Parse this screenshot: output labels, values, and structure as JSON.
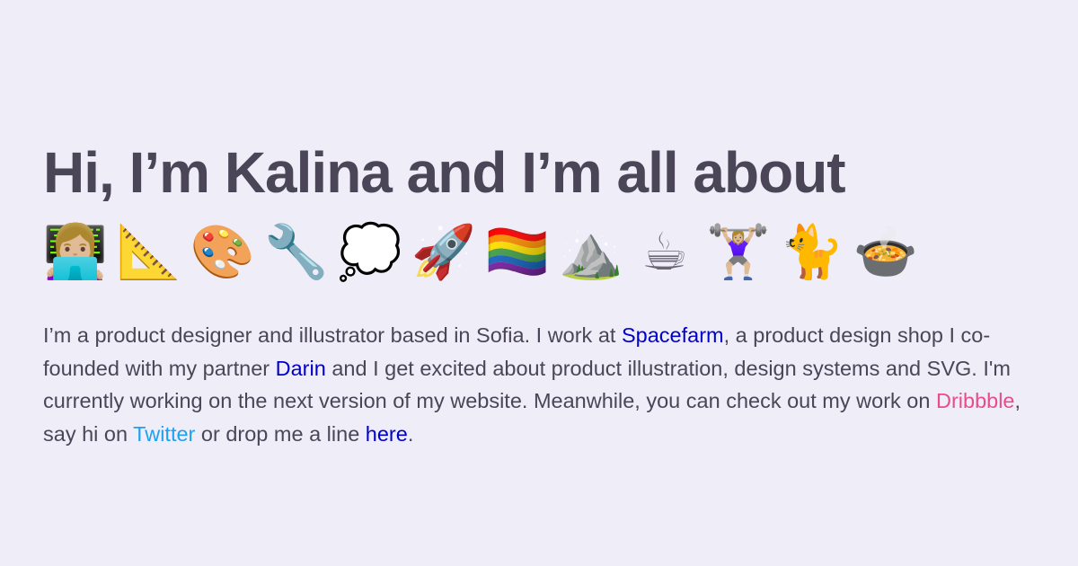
{
  "heading": "Hi, I’m Kalina and I’m all about",
  "emojis": [
    {
      "char": "👩🏼‍💻",
      "name": "woman-technologist-icon"
    },
    {
      "char": "📐",
      "name": "triangular-ruler-icon"
    },
    {
      "char": "🎨",
      "name": "artist-palette-icon"
    },
    {
      "char": "🔧",
      "name": "wrench-icon"
    },
    {
      "char": "💭",
      "name": "thought-balloon-icon"
    },
    {
      "char": "🚀",
      "name": "rocket-icon"
    },
    {
      "char": "🏳️‍🌈",
      "name": "rainbow-flag-icon"
    },
    {
      "char": "⛰️",
      "name": "mountain-icon"
    },
    {
      "char": "☕",
      "name": "hot-beverage-icon"
    },
    {
      "char": "🏋🏼‍♀️",
      "name": "woman-lifting-weights-icon"
    },
    {
      "char": "🐈",
      "name": "cat-icon"
    },
    {
      "char": "🍲",
      "name": "pot-of-food-icon"
    }
  ],
  "intro": {
    "t1": "I’m a product designer and illustrator based in Sofia. I work at ",
    "spacefarm": "Spacefarm",
    "t2": ", a product design shop I co-founded with my partner ",
    "darin": "Darin",
    "t3": " and I get excited about product illustration, design systems and SVG. I'm currently working on the next version of my website. Meanwhile, you can check out my work on ",
    "dribbble": "Dribbble",
    "t4": ", say hi on ",
    "twitter": "Twitter",
    "t5": " or drop me a line ",
    "here": "here",
    "t6": "."
  },
  "colors": {
    "background": "#efedf8",
    "text": "#4a4658",
    "link": "#0000cc",
    "dribbble": "#ea4c89",
    "twitter": "#1da1f2"
  }
}
